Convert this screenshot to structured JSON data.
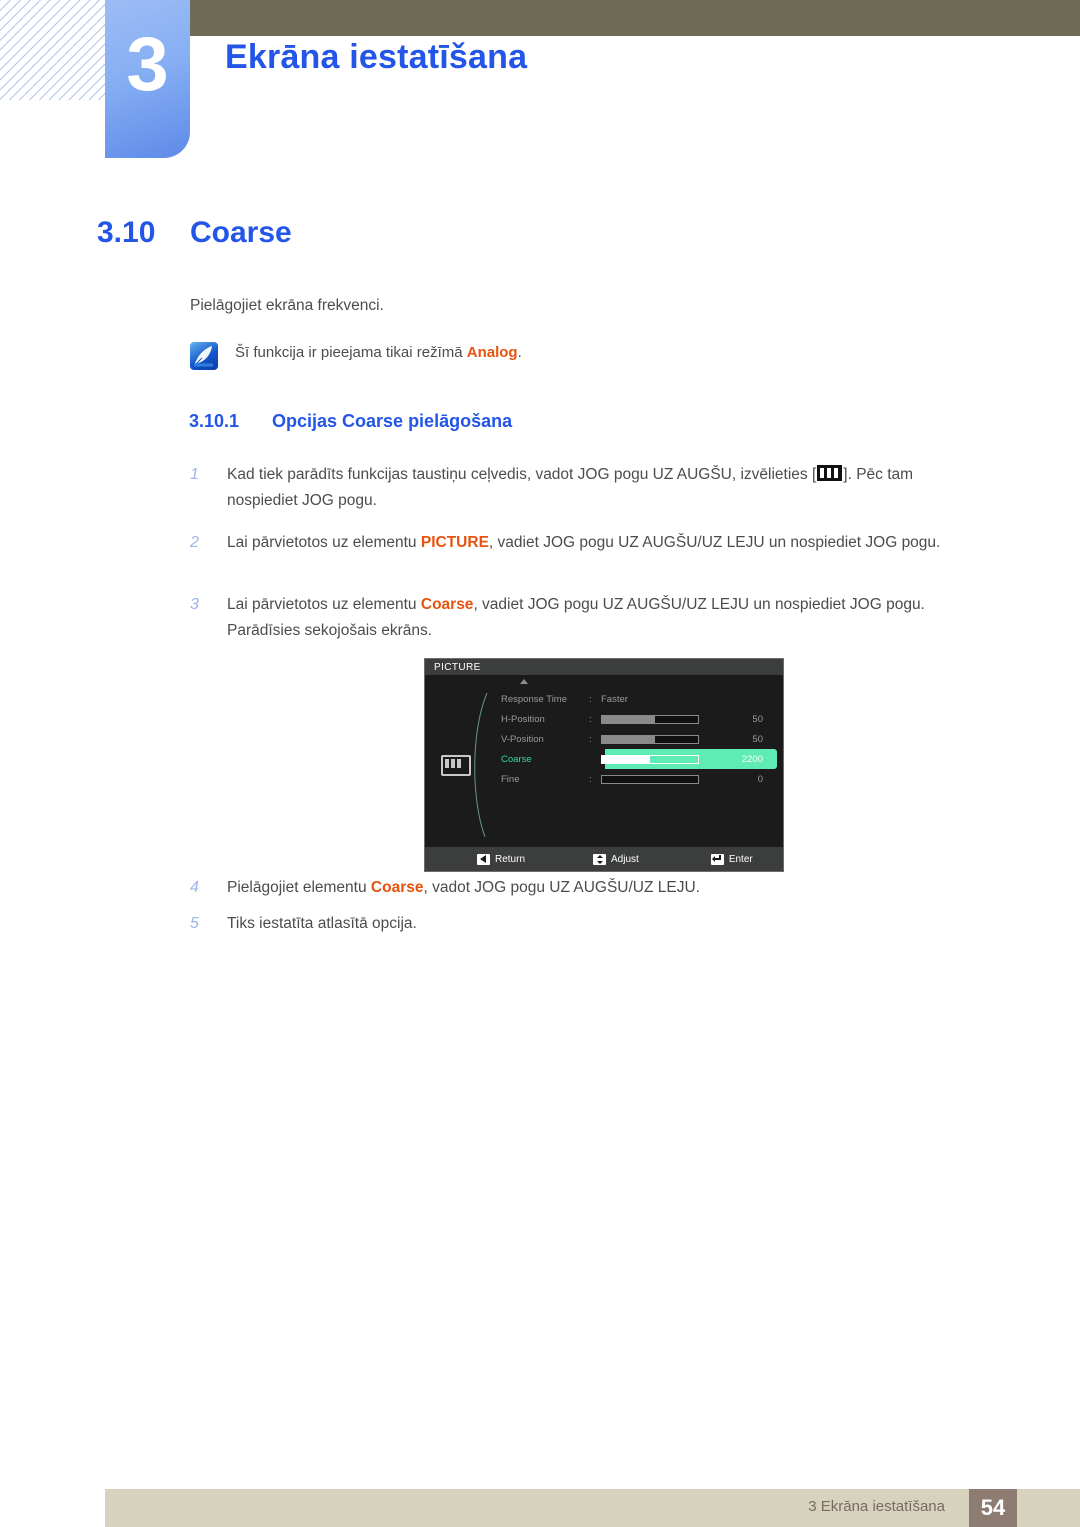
{
  "header": {
    "chapter_number": "3",
    "chapter_title": "Ekrāna iestatīšana",
    "olive_bar_color": "#6e6b56",
    "chapter_box_color": "#86aff3"
  },
  "section": {
    "number": "3.10",
    "title": "Coarse",
    "heading_color": "#2255e8"
  },
  "intro": "Pielāgojiet ekrāna frekvenci.",
  "note": {
    "icon": "quill-note-icon",
    "text_before": "Šī funkcija ir pieejama tikai režīmā ",
    "accent": "Analog",
    "text_after": "."
  },
  "subsection": {
    "number": "3.10.1",
    "title": "Opcijas Coarse pielāgošana"
  },
  "steps": [
    {
      "num": "1",
      "parts": [
        {
          "t": "Kad tiek parādīts funkcijas taustiņu ceļvedis, vadot JOG pogu UZ AUGŠU, izvēlieties ["
        },
        {
          "glyph": "picture-key-icon"
        },
        {
          "t": "]. Pēc tam nospiediet JOG pogu."
        }
      ]
    },
    {
      "num": "2",
      "parts": [
        {
          "t": "Lai pārvietotos uz elementu "
        },
        {
          "accent": "PICTURE"
        },
        {
          "t": ", vadiet JOG pogu UZ AUGŠU/UZ LEJU un nospiediet JOG pogu."
        }
      ]
    },
    {
      "num": "3",
      "parts": [
        {
          "t": "Lai pārvietotos uz elementu "
        },
        {
          "accent": "Coarse"
        },
        {
          "t": ", vadiet JOG pogu UZ AUGŠU/UZ LEJU un nospiediet JOG pogu. Parādīsies sekojošais ekrāns."
        }
      ]
    },
    {
      "num": "4",
      "parts": [
        {
          "t": "Pielāgojiet elementu "
        },
        {
          "accent": "Coarse"
        },
        {
          "t": ", vadot JOG pogu UZ AUGŠU/UZ LEJU."
        }
      ]
    },
    {
      "num": "5",
      "parts": [
        {
          "t": "Tiks iestatīta atlasītā opcija."
        }
      ]
    }
  ],
  "osd": {
    "title": "PICTURE",
    "side_icon": "picture-menu-icon",
    "scroll_up_indicator": "up-triangle-icon",
    "highlight_color": "#5fecb4",
    "rows": [
      {
        "label": "Response Time",
        "type": "text",
        "value": "Faster",
        "selected": false
      },
      {
        "label": "H-Position",
        "type": "slider",
        "value": "50",
        "fill": 55,
        "selected": false
      },
      {
        "label": "V-Position",
        "type": "slider",
        "value": "50",
        "fill": 55,
        "selected": false
      },
      {
        "label": "Coarse",
        "type": "slider",
        "value": "2200",
        "fill": 50,
        "selected": true
      },
      {
        "label": "Fine",
        "type": "slider",
        "value": "0",
        "fill": 0,
        "selected": false
      }
    ],
    "footer": [
      {
        "icon": "left-triangle-icon",
        "label": "Return"
      },
      {
        "icon": "up-down-arrow-icon",
        "label": "Adjust"
      },
      {
        "icon": "enter-arrow-icon",
        "label": "Enter"
      }
    ]
  },
  "footer": {
    "text": "3 Ekrāna iestatīšana",
    "page_number": "54",
    "band_color": "#d7d2bd",
    "page_box_color": "#8e7b71"
  }
}
